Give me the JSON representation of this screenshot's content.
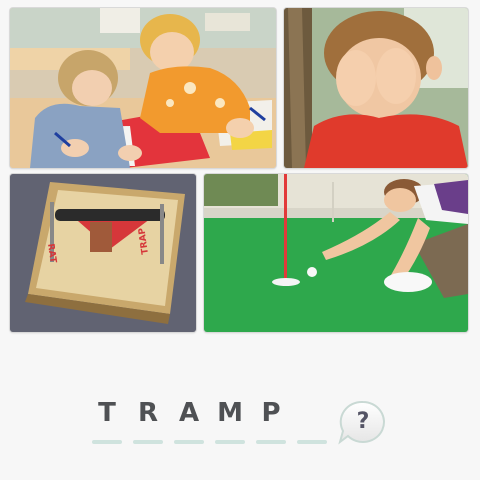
{
  "puzzle": {
    "images": [
      {
        "icon": "children-writing-image"
      },
      {
        "icon": "boy-covering-face-image"
      },
      {
        "icon": "mousetrap-image"
      },
      {
        "icon": "golfer-putting-image"
      }
    ],
    "trap_label": "RAT TRAP",
    "answer_letters": [
      "T",
      "R",
      "A",
      "M",
      "P",
      ""
    ],
    "hint_label": "?",
    "colors": {
      "slot_bar": "#cfe3de",
      "letter": "#4f5154",
      "putting_green": "#2ea84c",
      "flag_pole": "#e23a3a"
    }
  }
}
